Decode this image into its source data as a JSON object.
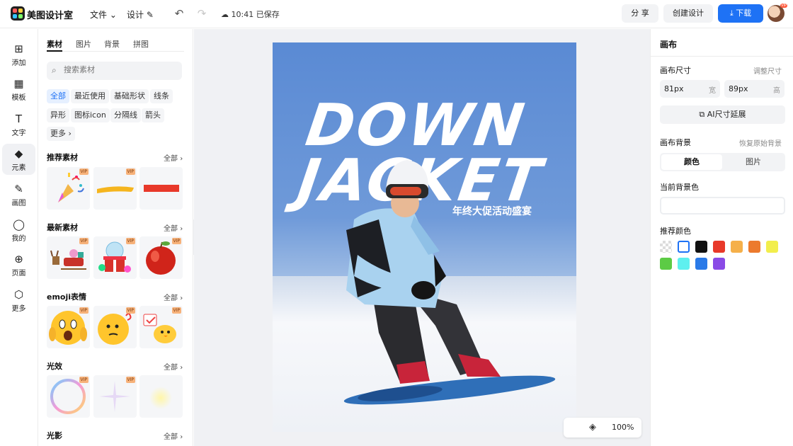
{
  "header": {
    "brand": "美图设计室",
    "menu_file": "文件",
    "menu_design": "设计",
    "save_status": "10:41 已保存",
    "share": "分 享",
    "create": "创建设计",
    "download": "下载",
    "avatar_badge": "VIP"
  },
  "rail": [
    {
      "label": "添加",
      "icon": "plus-square-icon"
    },
    {
      "label": "模板",
      "icon": "template-icon"
    },
    {
      "label": "文字",
      "icon": "text-icon"
    },
    {
      "label": "元素",
      "icon": "shapes-icon"
    },
    {
      "label": "画图",
      "icon": "pencil-icon"
    },
    {
      "label": "我的",
      "icon": "user-icon"
    },
    {
      "label": "页面",
      "icon": "page-add-icon"
    },
    {
      "label": "更多",
      "icon": "cube-icon"
    }
  ],
  "assets": {
    "tabs": [
      "素材",
      "图片",
      "背景",
      "拼图"
    ],
    "search_placeholder": "搜索素材",
    "chips": [
      "全部",
      "最近使用",
      "基础形状",
      "线条",
      "异形",
      "图标icon",
      "分隔线",
      "箭头",
      "更多"
    ],
    "all_label": "全部",
    "vip": "VIP",
    "sections": [
      "推荐素材",
      "最新素材",
      "emoji表情",
      "光效",
      "光影"
    ]
  },
  "canvas": {
    "line1": "DOWN",
    "line2": "JACKET",
    "subtitle": "年终大促活动盛宴",
    "zoom": "100%"
  },
  "right": {
    "title": "画布",
    "size_label": "画布尺寸",
    "adjust": "调整尺寸",
    "width_value": "81px",
    "width_unit": "宽",
    "height_value": "89px",
    "height_unit": "高",
    "ai_button": "AI尺寸延展",
    "bg_label": "画布背景",
    "restore": "恢复原始背景",
    "seg_color": "颜色",
    "seg_image": "图片",
    "current_bg": "当前背景色",
    "recommend": "推荐颜色",
    "swatches": [
      "transparent",
      "#ffffff",
      "#111111",
      "#e8392a",
      "#f5b04a",
      "#ec7a2d",
      "#f2ee4c",
      "#5ccb45",
      "#5ef0ef",
      "#2a7ae8",
      "#8a4be6"
    ]
  }
}
